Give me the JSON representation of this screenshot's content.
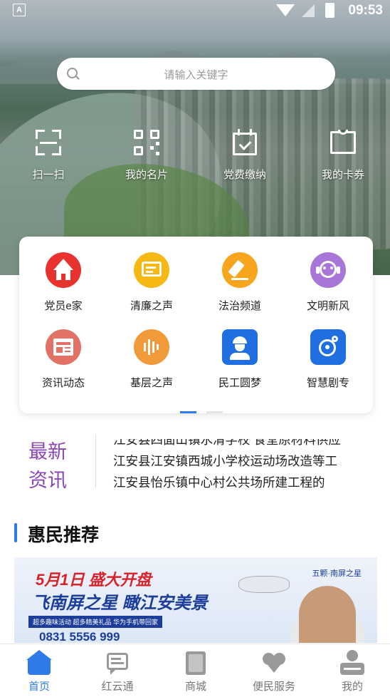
{
  "status": {
    "time": "09:53",
    "a_icon": "A"
  },
  "search": {
    "placeholder": "请输入关键字"
  },
  "quick_actions": [
    {
      "label": "扫一扫",
      "icon": "scan-icon"
    },
    {
      "label": "我的名片",
      "icon": "qr-code-icon"
    },
    {
      "label": "党费缴纳",
      "icon": "calendar-check-icon"
    },
    {
      "label": "我的卡券",
      "icon": "coupon-icon"
    }
  ],
  "grid": [
    {
      "label": "党员e家",
      "icon": "home-icon",
      "color": "#e8322d"
    },
    {
      "label": "清廉之声",
      "icon": "speech-icon",
      "color": "#f6b914"
    },
    {
      "label": "法治频道",
      "icon": "gavel-icon",
      "color": "#f7a51d"
    },
    {
      "label": "文明新风",
      "icon": "face-icon",
      "color": "#a876d8"
    },
    {
      "label": "资讯动态",
      "icon": "newspaper-icon",
      "color": "#e27265"
    },
    {
      "label": "基层之声",
      "icon": "microphone-icon",
      "color": "#f09a3a"
    },
    {
      "label": "民工圆梦",
      "icon": "worker-icon",
      "color": "#1f6fe0"
    },
    {
      "label": "智慧剧专",
      "icon": "drama-icon",
      "color": "#1f6fe0"
    }
  ],
  "news": {
    "tag_line1": "最新",
    "tag_line2": "资讯",
    "items": [
      "江安县四面山镇水清学校 食堂原材料供应",
      "江安县江安镇西城小学校运动场改造等工",
      "江安县怡乐镇中心村公共场所建工程的"
    ]
  },
  "section_title": "惠民推荐",
  "banner": {
    "line1": "5月1日  盛大开盘",
    "line2": "飞南屏之星  瞰江安美景",
    "line3": "超多趣味活动 超多精美礼品  华为手机带回家",
    "phone": "0831  5556 999",
    "logo": "五颗·南屏之星"
  },
  "tabs": [
    {
      "label": "首页",
      "icon": "home-tab-icon",
      "active": true
    },
    {
      "label": "红云通",
      "icon": "chat-tab-icon",
      "active": false
    },
    {
      "label": "商城",
      "icon": "shop-tab-icon",
      "active": false
    },
    {
      "label": "便民服务",
      "icon": "heart-tab-icon",
      "active": false
    },
    {
      "label": "我的",
      "icon": "profile-tab-icon",
      "active": false
    }
  ],
  "colors": {
    "accent": "#2f7bea",
    "news_tag": "#8a45b8",
    "tab_inactive": "#777777"
  },
  "pager": {
    "pages": 2,
    "current": 1
  }
}
